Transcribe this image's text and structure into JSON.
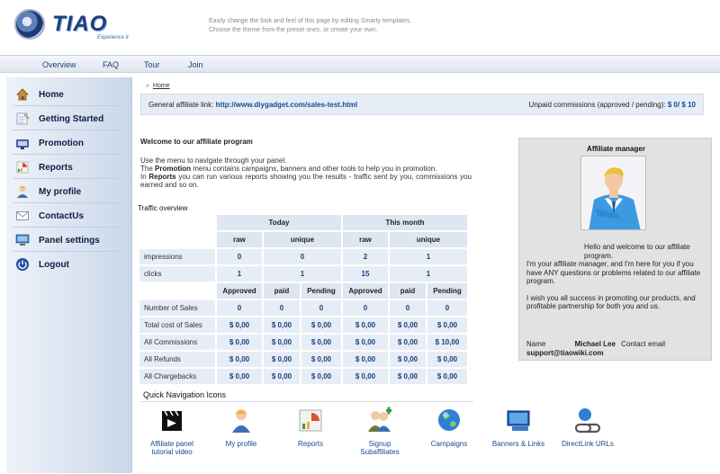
{
  "header": {
    "logo_text": "TIAO",
    "logo_sub": "Experience it",
    "note_line1": "Easily change the look and feel of this page by editing Smarty templates.",
    "note_line2": "Choose the theme from the preset ones, or create your own."
  },
  "topnav": [
    "Overview",
    "FAQ",
    "Tour",
    "Join"
  ],
  "sidebar": {
    "items": [
      {
        "label": "Home",
        "icon": "home-icon",
        "color": "#c98b3a"
      },
      {
        "label": "Getting Started",
        "icon": "notepad-icon",
        "color": "#8fa8c8"
      },
      {
        "label": "Promotion",
        "icon": "megaphone-icon",
        "color": "#4a5fa8"
      },
      {
        "label": "Reports",
        "icon": "chart-icon",
        "color": "#d9502f"
      },
      {
        "label": "My profile",
        "icon": "user-icon",
        "color": "#e8b23a"
      },
      {
        "label": "ContactUs",
        "icon": "mail-icon",
        "color": "#b9c4d6"
      },
      {
        "label": "Panel settings",
        "icon": "monitor-icon",
        "color": "#3d79c9"
      },
      {
        "label": "Logout",
        "icon": "power-icon",
        "color": "#2350a0"
      }
    ]
  },
  "breadcrumb": {
    "sep": "»",
    "home": "Home"
  },
  "affbar": {
    "label": "General affiliate link:",
    "link": "http://www.diygadget.com/sales-test.html",
    "unpaid_label": "Unpaid commissions (approved / pending):",
    "unpaid_value": "$ 0/ $ 10"
  },
  "welcome": {
    "title": "Welcome to our affiliate program",
    "line1": "Use the menu to navigate through your panel.",
    "line2_pre": "The ",
    "line2_bold": "Promotion",
    "line2_post": " menu contains campaigns, banners and other tools to help you in promotion.",
    "line3_pre": "In ",
    "line3_bold": "Reports",
    "line3_post": " you can run various reports showing you the results - traffic sent by you, commissions you earned and so on."
  },
  "manager": {
    "title": "Affiliate manager",
    "greeting": "Hello and welcome to our affiliate program.",
    "para1": "I'm your affiliate manager, and I'm here for you if you have ANY questions or problems related to our affiliate program.",
    "para2": "I wish you all success in promoting our products, and profitable partnership for both you and us.",
    "name_label": "Name",
    "name_value": "Michael Lee",
    "email_label": "Contact email",
    "email_value": "support@tiaowiki.com"
  },
  "traffic": {
    "title": "Traffic overview",
    "period_today": "Today",
    "period_month": "This month",
    "raw": "raw",
    "unique": "unique",
    "rows": [
      {
        "label": "impressions",
        "today_raw": "0",
        "today_unique": "0",
        "month_raw": "2",
        "month_unique": "1"
      },
      {
        "label": "clicks",
        "today_raw": "1",
        "today_unique": "1",
        "month_raw": "15",
        "month_unique": "1"
      }
    ],
    "status_headers": [
      "Approved",
      "paid",
      "Pending",
      "Approved",
      "paid",
      "Pending"
    ],
    "sales_rows": [
      {
        "label": "Number of Sales",
        "values": [
          "0",
          "0",
          "0",
          "0",
          "0",
          "0"
        ]
      },
      {
        "label": "Total cost of Sales",
        "values": [
          "$ 0,00",
          "$ 0,00",
          "$ 0,00",
          "$ 0,00",
          "$ 0,00",
          "$ 0,00"
        ]
      },
      {
        "label": "All Commissions",
        "values": [
          "$ 0,00",
          "$ 0,00",
          "$ 0,00",
          "$ 0,00",
          "$ 0,00",
          "$ 10,00"
        ]
      },
      {
        "label": "All Refunds",
        "values": [
          "$ 0,00",
          "$ 0,00",
          "$ 0,00",
          "$ 0,00",
          "$ 0,00",
          "$ 0,00"
        ]
      },
      {
        "label": "All Chargebacks",
        "values": [
          "$ 0,00",
          "$ 0,00",
          "$ 0,00",
          "$ 0,00",
          "$ 0,00",
          "$ 0,00"
        ]
      }
    ]
  },
  "quicknav": {
    "title": "Quick Navigation Icons",
    "items": [
      {
        "line1": "Affiliate panel",
        "line2": "tutorial video",
        "icon": "clapperboard-icon"
      },
      {
        "line1": "My profile",
        "line2": "",
        "icon": "user-icon"
      },
      {
        "line1": "Reports",
        "line2": "",
        "icon": "chart-icon"
      },
      {
        "line1": "Signup",
        "line2": "Subaffiliates",
        "icon": "add-users-icon"
      },
      {
        "line1": "Campaigns",
        "line2": "",
        "icon": "globe-icon"
      },
      {
        "line1": "Banners & Links",
        "line2": "",
        "icon": "banner-icon"
      },
      {
        "line1": "DirectLink URLs",
        "line2": "",
        "icon": "link-icon"
      }
    ]
  }
}
